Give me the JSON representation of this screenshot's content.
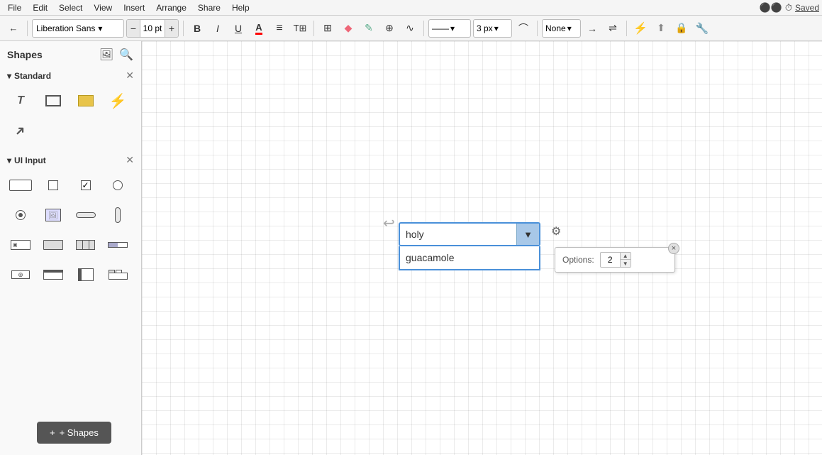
{
  "menubar": {
    "items": [
      "File",
      "Edit",
      "Select",
      "View",
      "Insert",
      "Arrange",
      "Share",
      "Help"
    ],
    "extras": [
      "●●",
      "⏱",
      "Saved"
    ],
    "saved_label": "Saved"
  },
  "toolbar": {
    "nav_arrow": "←",
    "font_family": "Liberation Sans",
    "font_family_arrow": "▾",
    "font_size_minus": "−",
    "font_size_value": "10 pt",
    "font_size_plus": "+",
    "bold": "B",
    "italic": "I",
    "underline": "U",
    "font_color": "A",
    "align": "≡",
    "text_format": "T",
    "insert_shapes": "⊞",
    "fill_color": "◆",
    "line_color": "◈",
    "connection": "⊕",
    "waypoint": "∿",
    "line_style_value": "——",
    "line_style_arrow": "▾",
    "line_width_value": "3 px",
    "line_width_arrow": "▾",
    "curve_btn": "⌒",
    "conn_none": "None",
    "conn_arrow": "▾",
    "arrow_start": "→",
    "arrow_mid": "⇌",
    "power": "⚡",
    "lock": "🔒",
    "wrench": "🔧"
  },
  "sidebar": {
    "title": "Shapes",
    "image_icon": "🖼",
    "search_icon": "🔍",
    "sections": [
      {
        "name": "Standard",
        "expanded": true,
        "shapes": [
          {
            "name": "text",
            "label": "T"
          },
          {
            "name": "rectangle",
            "label": "rect"
          },
          {
            "name": "rectangle-filled",
            "label": "rect-fill"
          },
          {
            "name": "lightning",
            "label": "⚡"
          },
          {
            "name": "arrow",
            "label": "↗"
          }
        ]
      },
      {
        "name": "UI Input",
        "expanded": true,
        "shapes": [
          {
            "name": "input-field",
            "label": "input"
          },
          {
            "name": "checkbox",
            "label": "check"
          },
          {
            "name": "checkbox-checked",
            "label": "check2"
          },
          {
            "name": "radio",
            "label": "radio"
          },
          {
            "name": "radio-selected",
            "label": "radio2"
          },
          {
            "name": "image-box",
            "label": "img"
          },
          {
            "name": "scrollbar-h",
            "label": "scroll-h"
          },
          {
            "name": "scrollbar-v",
            "label": "scroll-v"
          },
          {
            "name": "label-box",
            "label": "label"
          },
          {
            "name": "button",
            "label": "btn"
          },
          {
            "name": "button-group",
            "label": "btn-grp"
          },
          {
            "name": "progress",
            "label": "prog"
          },
          {
            "name": "zoom-ctrl",
            "label": "zoom"
          },
          {
            "name": "title-bar",
            "label": "title"
          },
          {
            "name": "panel",
            "label": "panel"
          },
          {
            "name": "tabs",
            "label": "tabs"
          }
        ]
      }
    ],
    "add_btn_label": "+ Shapes"
  },
  "canvas": {
    "dropdown": {
      "selected_text": "holy",
      "open_item_text": "guacamole",
      "arrow_char": "▼"
    },
    "options_popup": {
      "label": "Options:",
      "value": "2",
      "close_char": "×"
    }
  }
}
